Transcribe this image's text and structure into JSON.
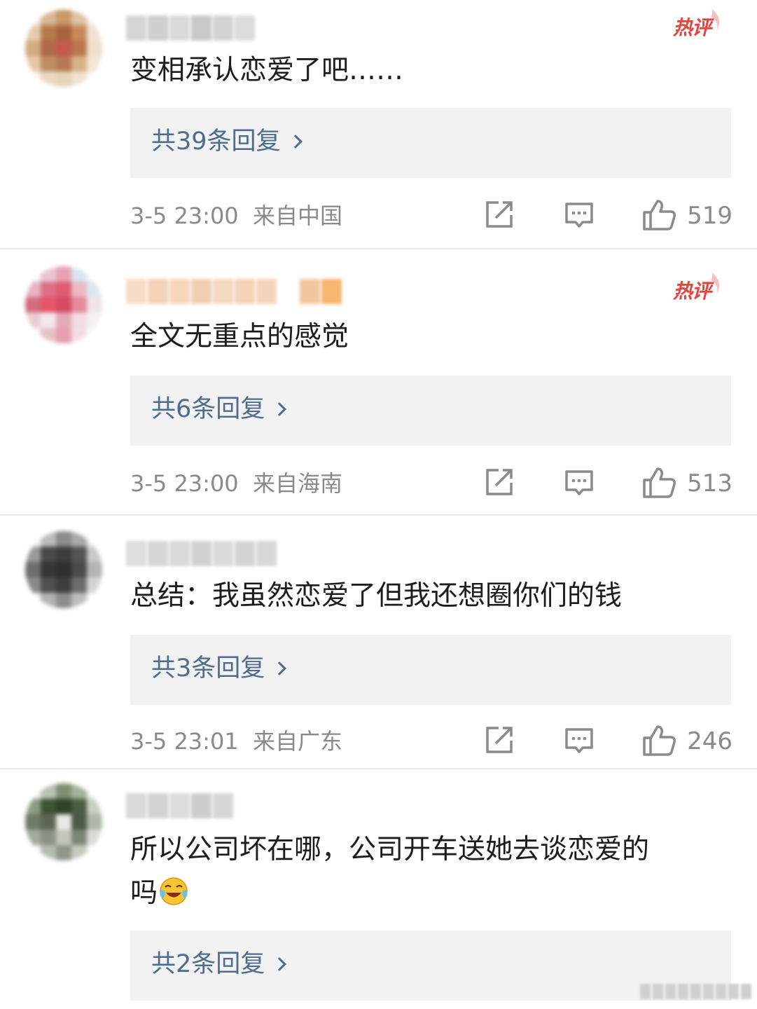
{
  "comments": [
    {
      "hot_badge": "热评",
      "text": "变相承认恋爱了吧……",
      "replies_label": "共39条回复",
      "time": "3-5 23:00",
      "location": "来自中国",
      "likes": "519",
      "avatar_colors": [
        "#f3ece4",
        "#d8b795",
        "#c89868",
        "#dec3a4",
        "#f7efe6",
        "#e6cbae",
        "#b7794b",
        "#a8643d",
        "#c68a5c",
        "#f0e2d2",
        "#d4aa80",
        "#b06a4a",
        "#c25b4d",
        "#b9764f",
        "#efe0cc",
        "#e4c7a4",
        "#c08d63",
        "#b57a53",
        "#d7b188",
        "#f2e6d8",
        "#f6efe8",
        "#ead7c0",
        "#e4d4b8",
        "#efe3cf",
        "#faf6f1"
      ],
      "name_colors": [
        "#d6d6d6",
        "#cfcfcf",
        "#dadada",
        "#c9c9c9",
        "#d3d3d3",
        "#dcdcdc"
      ]
    },
    {
      "hot_badge": "热评",
      "text": "全文无重点的感觉",
      "replies_label": "共6条回复",
      "time": "3-5 23:00",
      "location": "来自海南",
      "likes": "513",
      "avatar_colors": [
        "#f4f4f6",
        "#e8c6d1",
        "#e7a1b0",
        "#d9e5ef",
        "#f6f7f9",
        "#e7b3c0",
        "#dd6f86",
        "#e05b71",
        "#e9b9c4",
        "#dde7ef",
        "#d46c7f",
        "#e4566c",
        "#d44c63",
        "#e38a9c",
        "#f0e4e8",
        "#e9cdd3",
        "#f4e8ec",
        "#e3a9b6",
        "#f1dce2",
        "#f5f0f2",
        "#f7f3f5",
        "#e6c1ca",
        "#e79fb0",
        "#f1dde3",
        "#fbf8f9"
      ],
      "name_colors": [
        "#f7dcc7",
        "#f4d2b8",
        "#f5d6bd",
        "#f2cfb3",
        "#f6d8c1",
        "#f3d3b9",
        "#f5d4ba",
        "#ffffff",
        "#f2c7a0",
        "#f6b770"
      ]
    },
    {
      "text": "总结：我虽然恋爱了但我还想圈你们的钱",
      "replies_label": "共3条回复",
      "time": "3-5 23:01",
      "location": "来自广东",
      "likes": "246",
      "avatar_colors": [
        "#f2f2f2",
        "#bcbcbc",
        "#8b8b8b",
        "#a9a9a9",
        "#ededed",
        "#9a9a9a",
        "#4a4a4a",
        "#3d3d3d",
        "#555555",
        "#c9c9c9",
        "#6e6e6e",
        "#363636",
        "#2f2f2f",
        "#4b4b4b",
        "#b4b4b4",
        "#8a8a8a",
        "#505050",
        "#3e3e3e",
        "#6c6c6c",
        "#d4d4d4",
        "#f0f0f0",
        "#b3b3b3",
        "#8d8d8d",
        "#bdbdbd",
        "#f7f7f7"
      ],
      "name_colors": [
        "#dddddd",
        "#d6d6d6",
        "#d9d9d9",
        "#d1d1d1",
        "#dbdbdb",
        "#d4d4d4",
        "#d8d8d8"
      ]
    },
    {
      "text_line1": "所以公司坏在哪，公司开车送她去谈恋爱的",
      "text_line2": "吗",
      "replies_label": "共2条回复",
      "avatar_colors": [
        "#eef1ec",
        "#b8c3b0",
        "#7e9074",
        "#a4b39b",
        "#ecefe9",
        "#8e9c86",
        "#3f5338",
        "#2f4429",
        "#4b5e44",
        "#c8d0c2",
        "#6f7a69",
        "#5b6653",
        "#e8e8e4",
        "#4d5a47",
        "#aeb7a8",
        "#a2aa9c",
        "#8c9386",
        "#c1c7bb",
        "#7d8677",
        "#d9ddd5",
        "#f3f4f2",
        "#b6bcb1",
        "#8f978a",
        "#c5cac1",
        "#f9faf8"
      ],
      "name_colors": [
        "#d9d9d9",
        "#d2d2d2",
        "#dcdcdc",
        "#cdcdcd",
        "#d6d6d6"
      ]
    }
  ]
}
